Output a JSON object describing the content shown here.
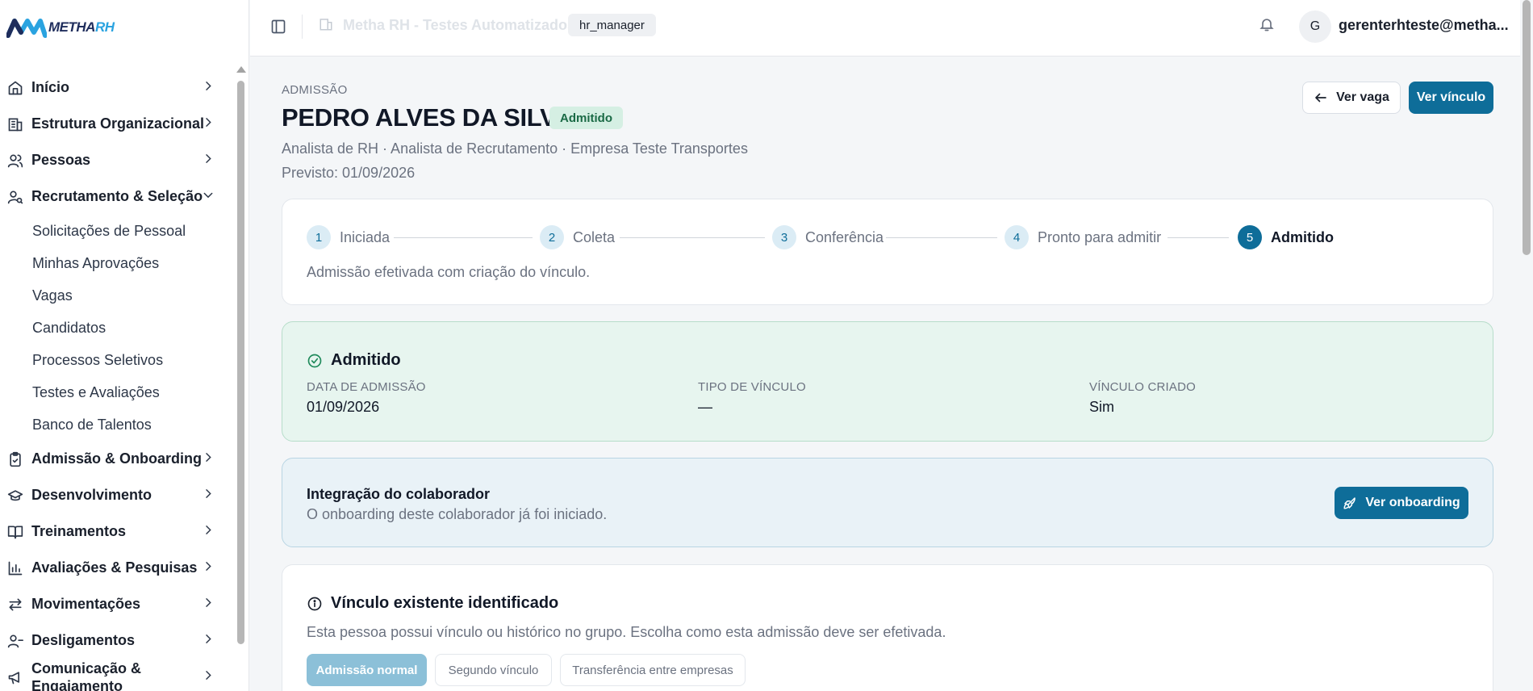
{
  "brand": {
    "logo_text_a": "METHA",
    "logo_text_b": "RH"
  },
  "header": {
    "company": "Metha RH - Testes Automatizados",
    "role": "hr_manager",
    "avatar_initial": "G",
    "user_email": "gerenterhteste@metha..."
  },
  "sidebar": {
    "items": [
      {
        "label": "Início",
        "icon": "home-icon"
      },
      {
        "label": "Estrutura Organizacional",
        "icon": "building-icon"
      },
      {
        "label": "Pessoas",
        "icon": "users-icon"
      },
      {
        "label": "Recrutamento & Seleção",
        "icon": "user-search-icon"
      },
      {
        "label": "Admissão & Onboarding",
        "icon": "clipboard-check-icon"
      },
      {
        "label": "Desenvolvimento",
        "icon": "graduation-cap-icon"
      },
      {
        "label": "Treinamentos",
        "icon": "book-open-icon"
      },
      {
        "label": "Avaliações & Pesquisas",
        "icon": "bar-chart-icon"
      },
      {
        "label": "Movimentações",
        "icon": "arrows-left-right-icon"
      },
      {
        "label": "Desligamentos",
        "icon": "user-minus-icon"
      },
      {
        "label_line1": "Comunicação &",
        "label_line2": "Engajamento",
        "icon": "megaphone-icon"
      }
    ],
    "recruit_sub": [
      "Solicitações de Pessoal",
      "Minhas Aprovações",
      "Vagas",
      "Candidatos",
      "Processos Seletivos",
      "Testes e Avaliações",
      "Banco de Talentos"
    ]
  },
  "page": {
    "overline": "ADMISSÃO",
    "title": "PEDRO ALVES DA SILVA",
    "status": "Admitido",
    "subtitle": "Analista de RH · Analista de Recrutamento · Empresa Teste Transportes",
    "expected": "Previsto: 01/09/2026",
    "btn_back": "Ver vaga",
    "btn_primary": "Ver vínculo"
  },
  "stepper": {
    "steps": [
      {
        "num": "1",
        "label": "Iniciada"
      },
      {
        "num": "2",
        "label": "Coleta"
      },
      {
        "num": "3",
        "label": "Conferência"
      },
      {
        "num": "4",
        "label": "Pronto para admitir"
      },
      {
        "num": "5",
        "label": "Admitido",
        "active": true
      }
    ],
    "description": "Admissão efetivada com criação do vínculo."
  },
  "admitted": {
    "title": "Admitido",
    "fields": [
      {
        "label": "DATA DE ADMISSÃO",
        "value": "01/09/2026"
      },
      {
        "label": "TIPO DE VÍNCULO",
        "value": "—"
      },
      {
        "label": "VÍNCULO CRIADO",
        "value": "Sim"
      }
    ]
  },
  "onboarding": {
    "title": "Integração do colaborador",
    "description": "O onboarding deste colaborador já foi iniciado.",
    "button": "Ver onboarding"
  },
  "vinculo": {
    "title": "Vínculo existente identificado",
    "description": "Esta pessoa possui vínculo ou histórico no grupo. Escolha como esta admissão deve ser efetivada.",
    "options": [
      "Admissão normal",
      "Segundo vínculo",
      "Transferência entre empresas"
    ],
    "selected": "Admissão normal"
  },
  "colors": {
    "primary": "#0e6d99",
    "success_bg": "#e7f5ef",
    "info_bg": "#e9f2f7"
  }
}
